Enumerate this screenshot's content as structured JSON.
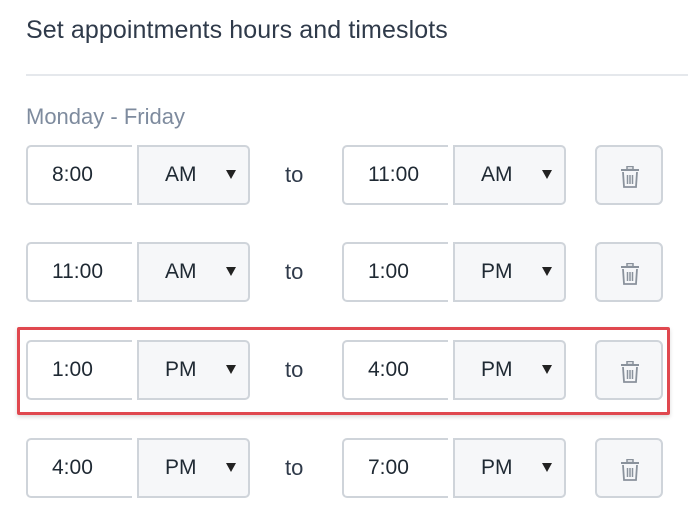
{
  "title": "Set appointments hours and timeslots",
  "schedule": {
    "day_label": "Monday - Friday",
    "to_label": "to",
    "slots": [
      {
        "start_time": "8:00",
        "start_ampm": "AM",
        "end_time": "11:00",
        "end_ampm": "AM"
      },
      {
        "start_time": "11:00",
        "start_ampm": "AM",
        "end_time": "1:00",
        "end_ampm": "PM"
      },
      {
        "start_time": "1:00",
        "start_ampm": "PM",
        "end_time": "4:00",
        "end_ampm": "PM",
        "highlighted": true
      },
      {
        "start_time": "4:00",
        "start_ampm": "PM",
        "end_time": "7:00",
        "end_ampm": "PM"
      }
    ]
  },
  "icons": {
    "delete": "trash-icon",
    "dropdown": "caret-down-icon"
  },
  "colors": {
    "highlight": "#e0484f",
    "border": "#cfd4da",
    "select_bg": "#f6f7f9",
    "title": "#2f3a4a",
    "day_label": "#7e8b9e"
  }
}
